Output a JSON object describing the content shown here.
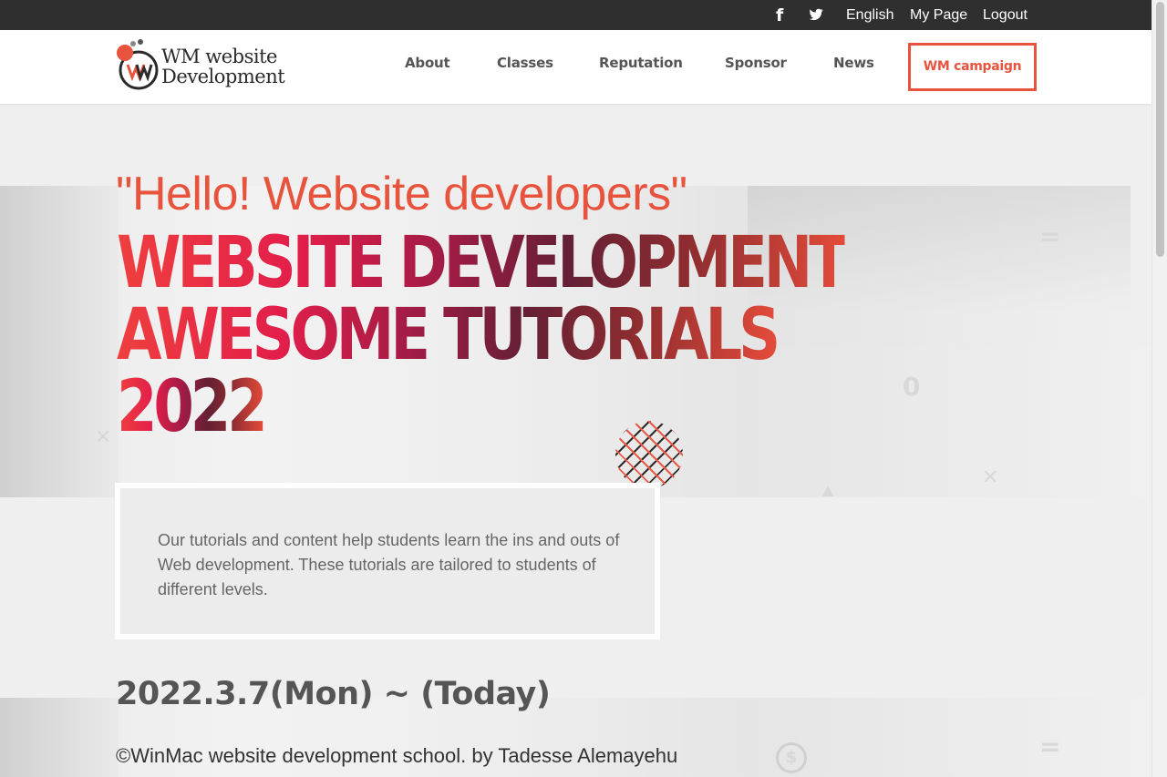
{
  "topbar": {
    "facebook_icon": "f",
    "twitter_icon": "🐦",
    "language": "English",
    "my_page": "My Page",
    "logout": "Logout"
  },
  "logo": {
    "line1": "WM website",
    "line2": "Development",
    "mark": "WM"
  },
  "nav": {
    "items": [
      {
        "label": "About"
      },
      {
        "label": "Classes"
      },
      {
        "label": "Reputation"
      },
      {
        "label": "Sponsor"
      },
      {
        "label": "News"
      }
    ],
    "campaign": "WM campaign"
  },
  "hero": {
    "greeting": "\"Hello! Website developers\"",
    "headline_lines": [
      "WEBSITE DEVELOPMENT",
      "AWESOME TUTORIALS",
      "2022"
    ]
  },
  "description": "Our tutorials and content help students learn the ins and outs of Web development. These tutorials are tailored to students of different levels.",
  "date_range": "2022.3.7(Mon) ~ (Today)",
  "copyright": "©WinMac website development school. by Tadesse Alemayehu",
  "colors": {
    "accent": "#e8533e",
    "topbar_bg": "#2f2f2f",
    "headline_start": "#ef3f3f",
    "headline_mid": "#652035"
  }
}
